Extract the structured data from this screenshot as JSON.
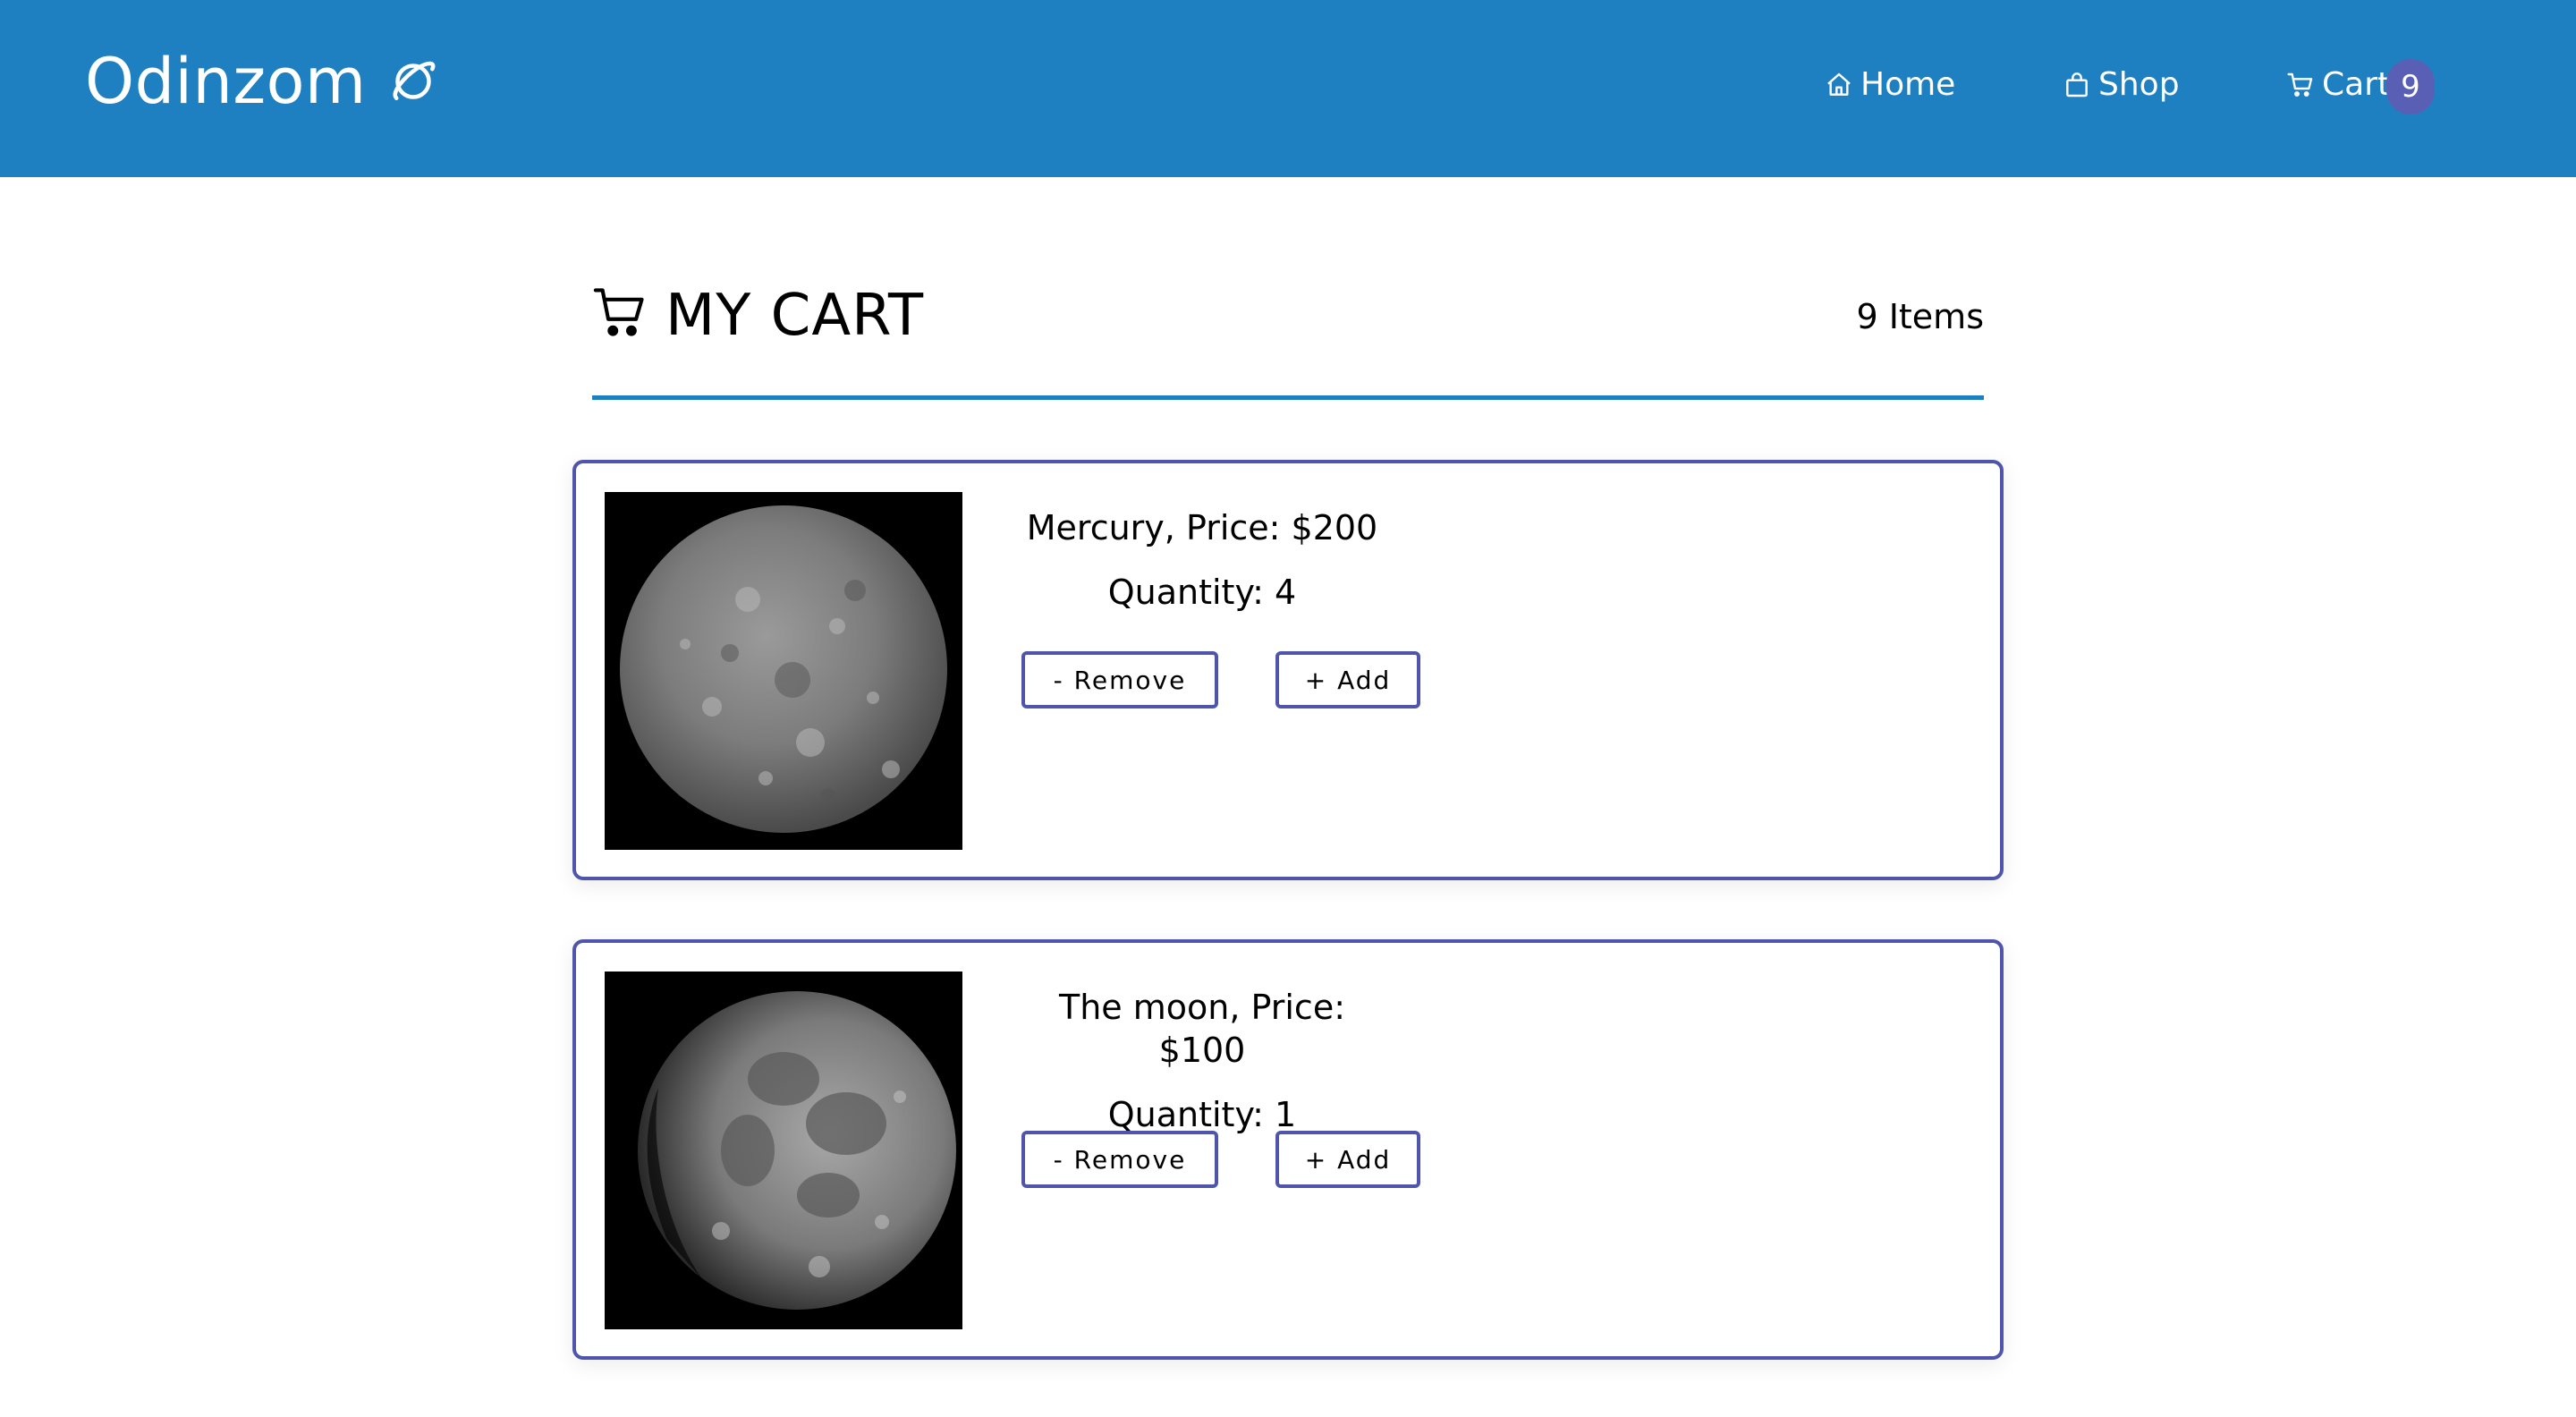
{
  "header": {
    "brand": "Odinzom",
    "brand_icon": "planet-icon",
    "nav": {
      "home": "Home",
      "shop": "Shop",
      "cart": "Cart",
      "cart_badge": "9"
    },
    "colors": {
      "bar": "#1e80c1",
      "badge": "#5a5fb6"
    }
  },
  "cart": {
    "title": "MY CART",
    "item_count": "9 Items",
    "items": [
      {
        "name_price": "Mercury, Price: $200",
        "quantity": "Quantity: 4",
        "remove_label": "- Remove",
        "add_label": "+ Add",
        "image": "mercury-planet-photo"
      },
      {
        "name_price": "The moon, Price: $100",
        "quantity": "Quantity: 1",
        "remove_label": "- Remove",
        "add_label": "+ Add",
        "image": "moon-photo"
      }
    ]
  }
}
